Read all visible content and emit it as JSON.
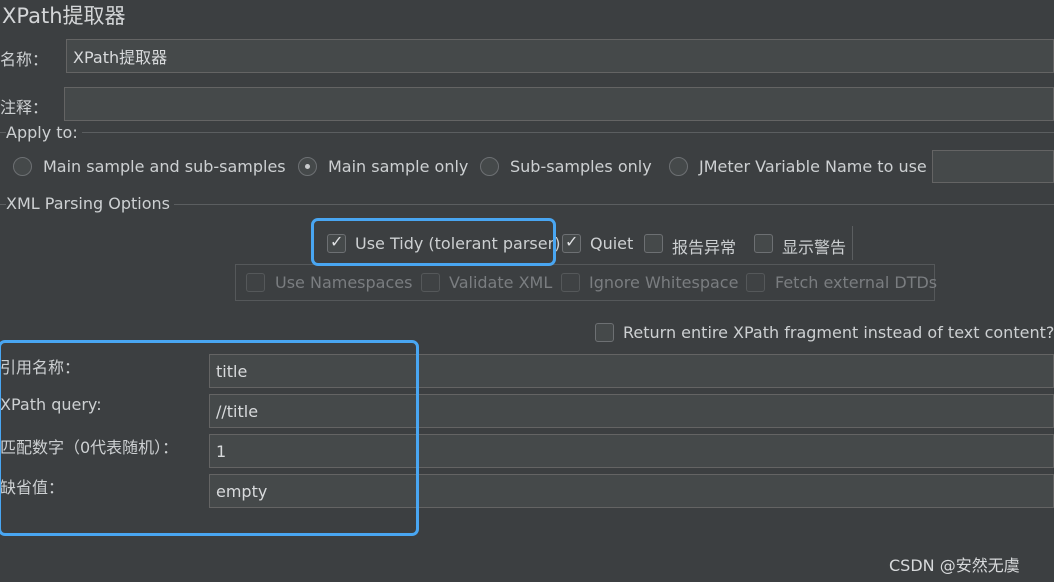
{
  "title": "XPath提取器",
  "name": {
    "label": "名称：",
    "value": "XPath提取器"
  },
  "comment": {
    "label": "注释：",
    "value": ""
  },
  "apply_to": {
    "title": "Apply to:",
    "options": [
      {
        "label": "Main sample and sub-samples",
        "selected": false
      },
      {
        "label": "Main sample only",
        "selected": true
      },
      {
        "label": "Sub-samples only",
        "selected": false
      },
      {
        "label": "JMeter Variable Name to use",
        "selected": false
      }
    ],
    "variable_value": ""
  },
  "xml_parsing": {
    "title": "XML Parsing Options",
    "row1": [
      {
        "label": "Use Tidy (tolerant parser)",
        "checked": true
      },
      {
        "label": "Quiet",
        "checked": true
      },
      {
        "label": "报告异常",
        "checked": false
      },
      {
        "label": "显示警告",
        "checked": false
      }
    ],
    "row2": [
      {
        "label": "Use Namespaces",
        "checked": false,
        "disabled": true
      },
      {
        "label": "Validate XML",
        "checked": false,
        "disabled": true
      },
      {
        "label": "Ignore Whitespace",
        "checked": false,
        "disabled": true
      },
      {
        "label": "Fetch external DTDs",
        "checked": false,
        "disabled": true
      }
    ]
  },
  "return_fragment": {
    "label": "Return entire XPath fragment instead of text content?",
    "checked": false
  },
  "fields": [
    {
      "label": "引用名称：",
      "value": "title"
    },
    {
      "label": "XPath query:",
      "value": "//title"
    },
    {
      "label": "匹配数字（0代表随机）：",
      "value": "1"
    },
    {
      "label": "缺省值：",
      "value": "empty"
    }
  ],
  "watermark": "CSDN @安然无虞",
  "colors": {
    "highlight": "#49a6f2",
    "background": "#3c3f41",
    "field": "#45494a"
  }
}
